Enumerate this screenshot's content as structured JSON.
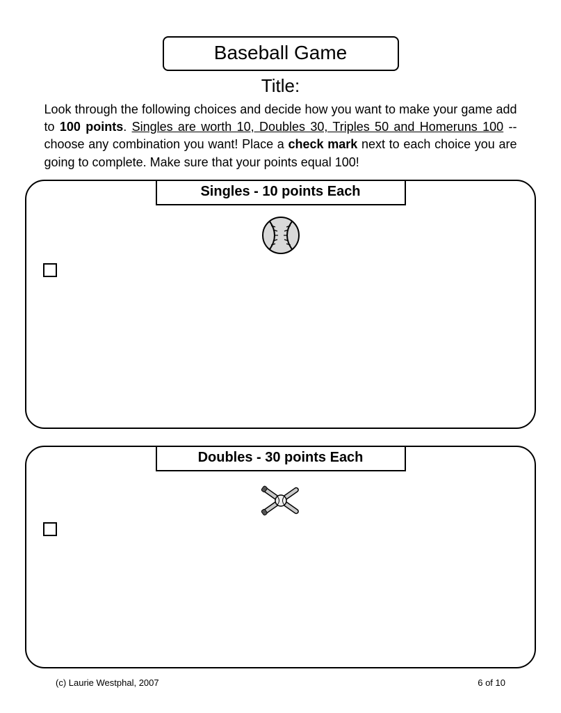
{
  "header": {
    "title": "Baseball Game",
    "subtitle": "Title:"
  },
  "instructions": {
    "part1": "Look through the following choices and decide how you want to make your game add to ",
    "bold_points": "100 points",
    "part2": ".  ",
    "underline_rules": "Singles are worth 10, Doubles 30, Triples 50 and Homeruns 100",
    "part3": " -- choose any combination you want! Place a ",
    "bold_check": "check mark",
    "part4": " next to each choice you are going to complete.  Make sure that your points equal 100!"
  },
  "sections": {
    "singles": {
      "label": "Singles - 10 points Each"
    },
    "doubles": {
      "label": "Doubles - 30 points Each"
    }
  },
  "footer": {
    "copyright": "(c) Laurie Westphal, 2007",
    "page": "6 of 10"
  }
}
